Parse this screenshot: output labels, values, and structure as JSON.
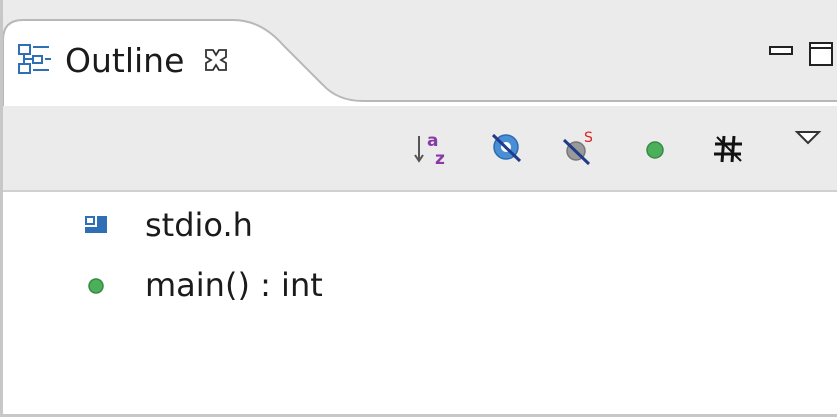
{
  "view": {
    "tab_title": "Outline",
    "tab_icon": "outline-view-icon",
    "close_icon": "close-tab-icon",
    "controls": [
      "minimize-icon",
      "maximize-icon"
    ]
  },
  "toolbar": {
    "buttons": [
      {
        "name": "sort-alphabetically-button",
        "icon": "sort-az-icon"
      },
      {
        "name": "hide-fields-button",
        "icon": "hide-fields-icon"
      },
      {
        "name": "hide-static-members-button",
        "icon": "hide-static-icon"
      },
      {
        "name": "hide-non-public-members-button",
        "icon": "hide-non-public-icon"
      },
      {
        "name": "hide-macros-button",
        "icon": "hide-macros-icon"
      },
      {
        "name": "view-menu-button",
        "icon": "chevron-down-icon"
      }
    ]
  },
  "outline": {
    "items": [
      {
        "label": "stdio.h",
        "icon": "include-icon"
      },
      {
        "label": "main() : int",
        "icon": "function-icon"
      }
    ]
  },
  "colors": {
    "tab_background": "#ffffff",
    "toolbar_background": "#ebebeb",
    "include_icon": "#2f6fb5",
    "function_icon": "#4caf5a",
    "sort_letters": "#8a3aa6"
  }
}
